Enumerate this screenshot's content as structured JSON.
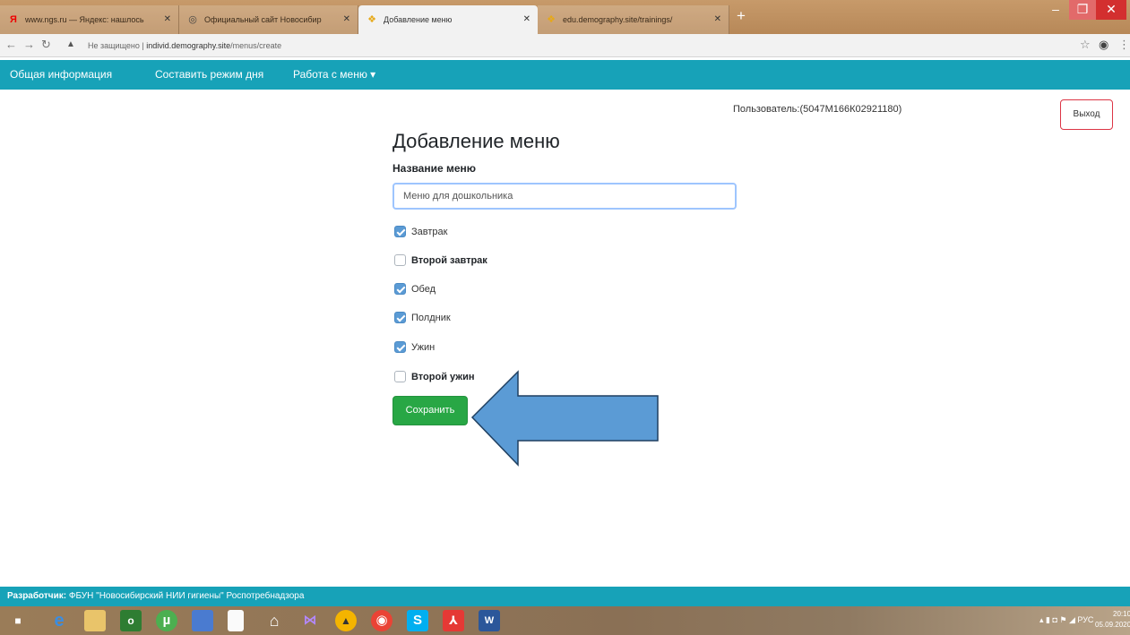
{
  "browser": {
    "tabs": [
      {
        "title": "www.ngs.ru — Яндекс: нашлось",
        "favicon": "yandex-icon",
        "active": false
      },
      {
        "title": "Официальный сайт Новосибир",
        "favicon": "globe-icon",
        "active": false
      },
      {
        "title": "Добавление меню",
        "favicon": "site-icon",
        "active": true
      },
      {
        "title": "edu.demography.site/trainings/",
        "favicon": "site-icon",
        "active": false
      }
    ],
    "new_tab": "+",
    "window_controls": {
      "minimize": "–",
      "maximize": "❐",
      "close": "✕"
    },
    "address": {
      "security": "Не защищено",
      "host": "individ.demography.site",
      "path": "/menus/create"
    }
  },
  "navbar": {
    "items": [
      {
        "label": "Общая информация"
      },
      {
        "label": "Составить режим дня"
      },
      {
        "label": "Работа с меню ▾"
      }
    ]
  },
  "user": {
    "label": "Пользователь:(5047М166К02921180)",
    "logout": "Выход"
  },
  "form": {
    "title": "Добавление меню",
    "name_label": "Название меню",
    "name_value": "Меню для дошкольника",
    "meals": [
      {
        "label": "Завтрак",
        "checked": true
      },
      {
        "label": "Второй завтрак",
        "checked": false
      },
      {
        "label": "Обед",
        "checked": true
      },
      {
        "label": "Полдник",
        "checked": true
      },
      {
        "label": "Ужин",
        "checked": true
      },
      {
        "label": "Второй ужин",
        "checked": false
      }
    ],
    "save_label": "Сохранить"
  },
  "footer": {
    "prefix": "Разработчик:",
    "text": " ФБУН \"Новосибирский НИИ гигиены\" Роспотребнадзора"
  },
  "taskbar": {
    "tray_lang": "РУС",
    "time": "20:10",
    "date": "05.09.2020"
  },
  "colors": {
    "navbar": "#17a2b8",
    "save": "#28a745",
    "arrow": "#5b9bd5",
    "logout_border": "#dc3545"
  }
}
